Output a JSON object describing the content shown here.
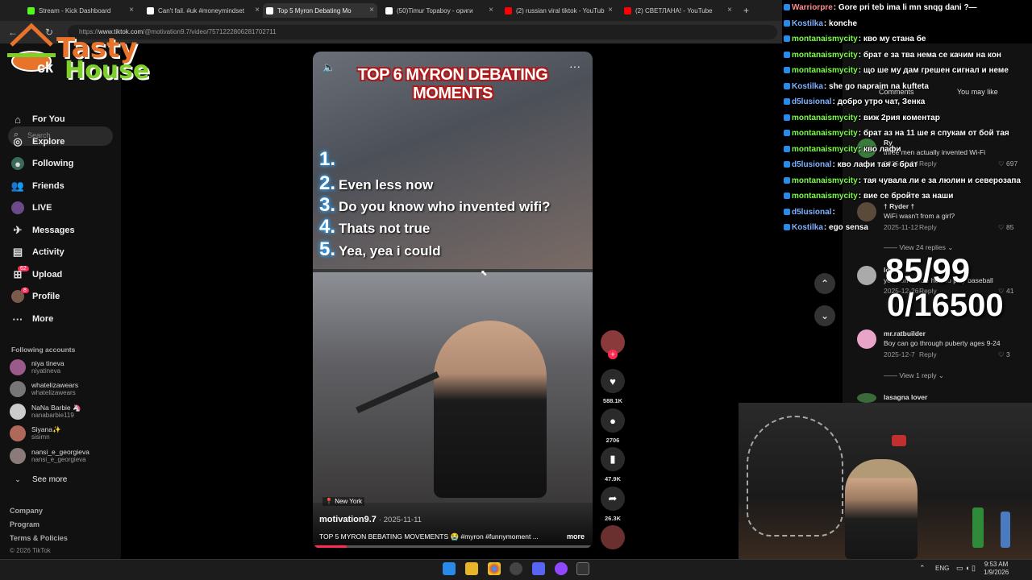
{
  "tabs": [
    {
      "title": "Stream - Kick Dashboard",
      "color": "#53fc18"
    },
    {
      "title": "Can't fail. #uk #moneymindset",
      "color": "#ffffff"
    },
    {
      "title": "Top 5 Myron Debating Mo",
      "color": "#ffffff"
    },
    {
      "title": "(50)Timur Topaboy - ориги",
      "color": "#ffffff"
    },
    {
      "title": "(2) russian viral tiktok - YouTub",
      "color": "#ff0000"
    },
    {
      "title": "(2) СВЕТЛАНА! - YouTube",
      "color": "#ff0000"
    }
  ],
  "url": {
    "prefix": "https://",
    "host": "www.tiktok.com",
    "path": "/@motivation9.7/video/7571222806281702711"
  },
  "logo": {
    "line1": "Tasty",
    "line2": "House",
    "tiktok_partial": "ck"
  },
  "sidebar": {
    "search_placeholder": "Search",
    "nav": [
      {
        "label": "For You",
        "icon": "home-icon"
      },
      {
        "label": "Explore",
        "icon": "compass-icon"
      },
      {
        "label": "Following",
        "icon": "following-icon"
      },
      {
        "label": "Friends",
        "icon": "friends-icon"
      },
      {
        "label": "LIVE",
        "icon": "live-icon"
      },
      {
        "label": "Messages",
        "icon": "messages-icon",
        "badge": "62"
      },
      {
        "label": "Activity",
        "icon": "activity-icon",
        "badge": "8"
      },
      {
        "label": "Upload",
        "icon": "upload-icon"
      },
      {
        "label": "Profile",
        "icon": "profile-icon"
      },
      {
        "label": "More",
        "icon": "more-icon"
      }
    ],
    "following_title": "Following accounts",
    "following": [
      {
        "name": "niya tineva",
        "handle": "niyatineva"
      },
      {
        "name": "whatelizawears",
        "handle": "whatelizawears"
      },
      {
        "name": "NaNa Barbie 🦄",
        "handle": "nanabarbie119"
      },
      {
        "name": "Siyana✨",
        "handle": "sisimn"
      },
      {
        "name": "nansi_e_georgieva",
        "handle": "nansi_e_georgieva"
      }
    ],
    "see_more": "See more",
    "footer": [
      "Company",
      "Program",
      "Terms & Policies",
      "© 2026 TikTok"
    ]
  },
  "video": {
    "title_line1": "TOP 6 MYRON DEBATING",
    "title_line2": "MOMENTS",
    "list": [
      {
        "num": "1.",
        "text": ""
      },
      {
        "num": "2.",
        "text": "Even less now"
      },
      {
        "num": "3.",
        "text": "Do you know who invented wifi?"
      },
      {
        "num": "4.",
        "text": "Thats not true"
      },
      {
        "num": "5.",
        "text": "Yea, yea i could"
      }
    ],
    "location": "New York",
    "author": "motivation9.7",
    "date": "· 2025-11-11",
    "description": "TOP 5 MYRON BEBATING MOVEMENTS 😭 #myron #funnymoment ...",
    "more": "more",
    "progress": 0.12
  },
  "actions": {
    "likes": "588.1K",
    "comments": "2706",
    "saves": "47.9K",
    "shares": "26.3K"
  },
  "comments_panel": {
    "tab_comments": "Comments",
    "tab_you_may_like": "You may like",
    "comments": [
      {
        "user": "Ry",
        "text": "three men actually invented Wi-Fi",
        "date": "2025-11-14",
        "reply": "Reply",
        "likes": "697"
      },
      {
        "user": "† Ryder †",
        "text": "WiFi wasn't from a girl?",
        "date": "2025-11-12",
        "reply": "Reply",
        "likes": "85"
      },
      {
        "user": "lo",
        "text": "you don't know how to play baseball",
        "date": "2025-12-26",
        "reply": "Reply",
        "likes": "41"
      },
      {
        "user": "mr.ratbuilder",
        "text": "Boy can go through puberty ages 9-24",
        "date": "2025-12-7",
        "reply": "Reply",
        "likes": "3"
      },
      {
        "user": "lasagna lover",
        "text": "",
        "date": "",
        "reply": "",
        "likes": ""
      }
    ],
    "view_replies_1": "View 24 replies",
    "view_replies_2": "View 1 reply"
  },
  "chat": [
    {
      "user": "Warriorpre",
      "color": "#ff8c8c",
      "text": "Gore pri teb ima li mn snqg dani ?—"
    },
    {
      "user": "Kostilka",
      "color": "#7fb2ff",
      "text": "konche"
    },
    {
      "user": "montanaismycity",
      "color": "#7cfc4a",
      "text": "кво му стана бе"
    },
    {
      "user": "montanaismycity",
      "color": "#7cfc4a",
      "text": "брат е за тва нема се качим на кон"
    },
    {
      "user": "montanaismycity",
      "color": "#7cfc4a",
      "text": "що ше му дам грешен сигнал и неме"
    },
    {
      "user": "Kostilka",
      "color": "#7fb2ff",
      "text": "she go napraim na kufteta"
    },
    {
      "user": "d5lusional",
      "color": "#7fb2ff",
      "text": "добро утро чат, Зенка"
    },
    {
      "user": "montanaismycity",
      "color": "#7cfc4a",
      "text": "виж 2рия коментар"
    },
    {
      "user": "montanaismycity",
      "color": "#7cfc4a",
      "text": "брат аз на 11 ше я спукам от бой тая"
    },
    {
      "user": "montanaismycity",
      "color": "#7cfc4a",
      "text": "кво лафи"
    },
    {
      "user": "d5lusional",
      "color": "#7fb2ff",
      "text": "кво лафи тая е брат"
    },
    {
      "user": "montanaismycity",
      "color": "#7cfc4a",
      "text": "тая чувала ли е за люлин и северозапа"
    },
    {
      "user": "montanaismycity",
      "color": "#7cfc4a",
      "text": "вие се бройте за наши"
    },
    {
      "user": "d5lusional",
      "color": "#7fb2ff",
      "text": ""
    },
    {
      "user": "Kostilka",
      "color": "#7fb2ff",
      "text": "ego sensa"
    }
  ],
  "counter": {
    "line1": "85/99",
    "line2": "0/16500"
  },
  "taskbar": {
    "lang": "ENG",
    "time": "9:53 AM",
    "date": "1/9/2026"
  }
}
